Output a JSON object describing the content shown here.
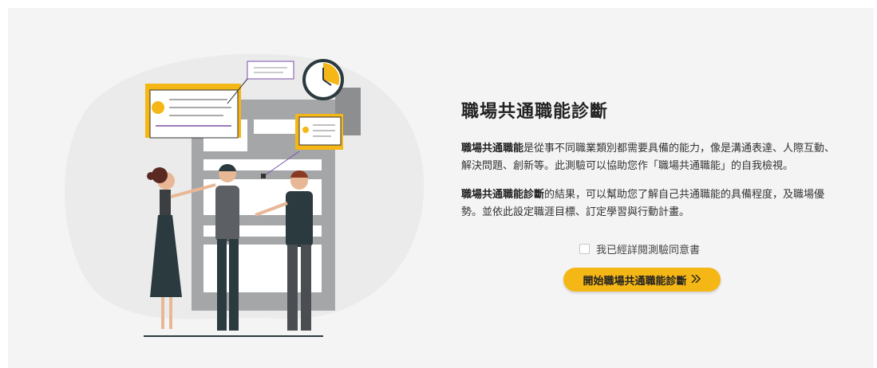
{
  "intro": {
    "title": "職場共通職能診斷",
    "para1_bold": "職場共通職能",
    "para1_rest": "是從事不同職業類別都需要具備的能力，像是溝通表達、人際互動、解決問題、創新等。此測驗可以協助您作「職場共通職能」的自我檢視。",
    "para2_bold": "職場共通職能診斷",
    "para2_rest": "的結果，可以幫助您了解自己共通職能的具備程度，及職場優勢。並依此設定職涯目標、訂定學習與行動計畫。"
  },
  "agreement": {
    "label": "我已經詳閱測驗同意書",
    "checked": false
  },
  "start_button": {
    "label": "開始職場共通職能診斷",
    "icon": "double-chevron-right-icon"
  },
  "colors": {
    "accent": "#f5b715",
    "background": "#f4f4f4",
    "text": "#222222"
  }
}
